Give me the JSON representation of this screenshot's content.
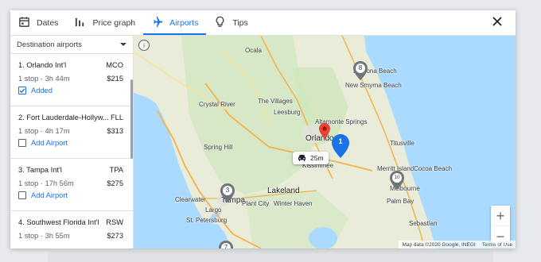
{
  "tabs": [
    {
      "label": "Dates",
      "icon": "calendar-icon"
    },
    {
      "label": "Price graph",
      "icon": "bar-chart-icon"
    },
    {
      "label": "Airports",
      "icon": "airplane-icon"
    },
    {
      "label": "Tips",
      "icon": "lightbulb-icon"
    }
  ],
  "active_tab": "Airports",
  "sidebar": {
    "dropdown_label": "Destination airports",
    "airports": [
      {
        "name": "1. Orlando Int'l",
        "code": "MCO",
        "details": "1 stop · 3h 44m",
        "price": "$215",
        "action": "Added",
        "checked": true
      },
      {
        "name": "2. Fort Lauderdale-Hollyw...",
        "code": "FLL",
        "details": "1 stop · 4h 17m",
        "price": "$313",
        "action": "Add Airport",
        "checked": false
      },
      {
        "name": "3. Tampa Int'l",
        "code": "TPA",
        "details": "1 stop · 17h 56m",
        "price": "$275",
        "action": "Add Airport",
        "checked": false
      },
      {
        "name": "4. Southwest Florida Int'l",
        "code": "RSW",
        "details": "1 stop · 3h 55m",
        "price": "$273",
        "action": "",
        "checked": false
      }
    ]
  },
  "map": {
    "drive_time": "25m",
    "zoom_in": "+",
    "zoom_out": "−",
    "info": "i",
    "attribution": "Map data ©2020 Google, INEGI",
    "terms": "Terms of Use",
    "pins": [
      {
        "number": "1",
        "color": "#1a73e8"
      },
      {
        "number": "3",
        "color": "#70757a"
      },
      {
        "number": "7",
        "color": "#70757a"
      },
      {
        "number": "8",
        "color": "#70757a"
      },
      {
        "number": "10",
        "color": "#70757a"
      }
    ],
    "labels": {
      "ocala": "Ocala",
      "daytona": "Daytona Beach",
      "new_smyrna": "New Smyrna Beach",
      "crystal_river": "Crystal River",
      "the_villages": "The Villages",
      "leesburg": "Leesburg",
      "altamonte": "Altamonte Springs",
      "orlando": "Orlando",
      "titusville": "Titusville",
      "spring_hill": "Spring Hill",
      "kissimmee": "Kissimmee",
      "merritt": "Merritt Island",
      "cocoa": "Cocoa Beach",
      "melbourne": "Melbourne",
      "lakeland": "Lakeland",
      "clearwater": "Clearwater",
      "tampa": "Tampa",
      "plant_city": "Plant City",
      "winter_haven": "Winter Haven",
      "palm_bay": "Palm Bay",
      "largo": "Largo",
      "st_pete": "St. Petersburg",
      "sebastian": "Sebastian"
    }
  },
  "colors": {
    "accent": "#1a73e8",
    "destination_pin": "#ea4335"
  }
}
